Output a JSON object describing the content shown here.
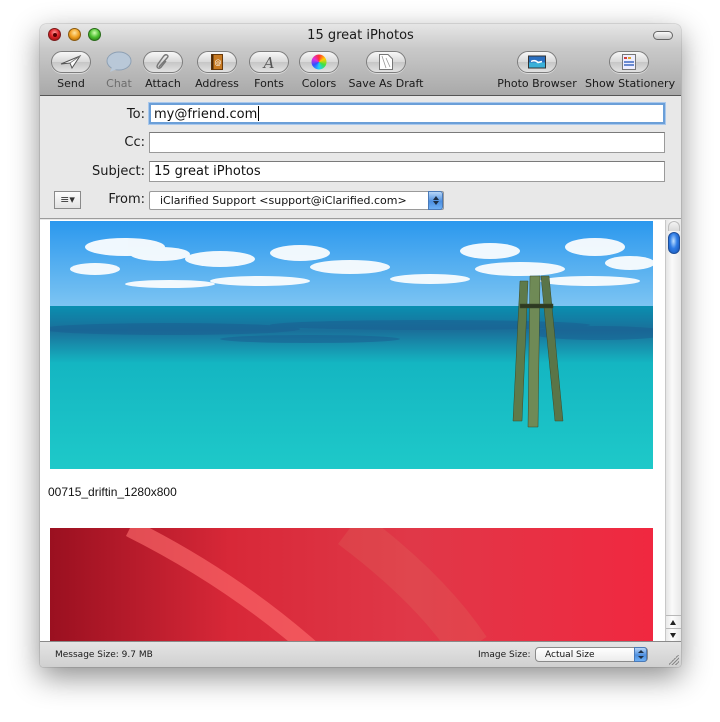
{
  "window": {
    "title": "15 great iPhotos"
  },
  "toolbar": {
    "items": [
      {
        "label": "Send",
        "icon": "send-icon",
        "enabled": true
      },
      {
        "label": "Chat",
        "icon": "chat-icon",
        "enabled": false
      },
      {
        "label": "Attach",
        "icon": "paperclip-icon",
        "enabled": true
      },
      {
        "label": "Address",
        "icon": "address-book-icon",
        "enabled": true
      },
      {
        "label": "Fonts",
        "icon": "fonts-icon",
        "enabled": true
      },
      {
        "label": "Colors",
        "icon": "color-wheel-icon",
        "enabled": true
      },
      {
        "label": "Save As Draft",
        "icon": "draft-icon",
        "enabled": true
      },
      {
        "label": "Photo Browser",
        "icon": "photo-browser-icon",
        "enabled": true
      },
      {
        "label": "Show Stationery",
        "icon": "stationery-icon",
        "enabled": true
      }
    ]
  },
  "header": {
    "to_label": "To:",
    "to_value": "my@friend.com",
    "cc_label": "Cc:",
    "cc_value": "",
    "subject_label": "Subject:",
    "subject_value": "15 great iPhotos",
    "from_label": "From:",
    "from_value": "iClarified Support <support@iClarified.com>",
    "action_menu_glyph": "≡▾"
  },
  "body": {
    "attachments": [
      {
        "caption": "00715_driftin_1280x800",
        "description": "turquoise sea with wooden pilings and clouds"
      },
      {
        "caption": "",
        "description": "red blurred abstract"
      }
    ]
  },
  "status": {
    "message_size": "Message Size: 9.7 MB",
    "image_size_label": "Image Size:",
    "image_size_value": "Actual Size"
  },
  "colors": {
    "focus_ring": "#6b9fd8",
    "sea": "#16b8c4",
    "sky": "#2fa0f0"
  }
}
